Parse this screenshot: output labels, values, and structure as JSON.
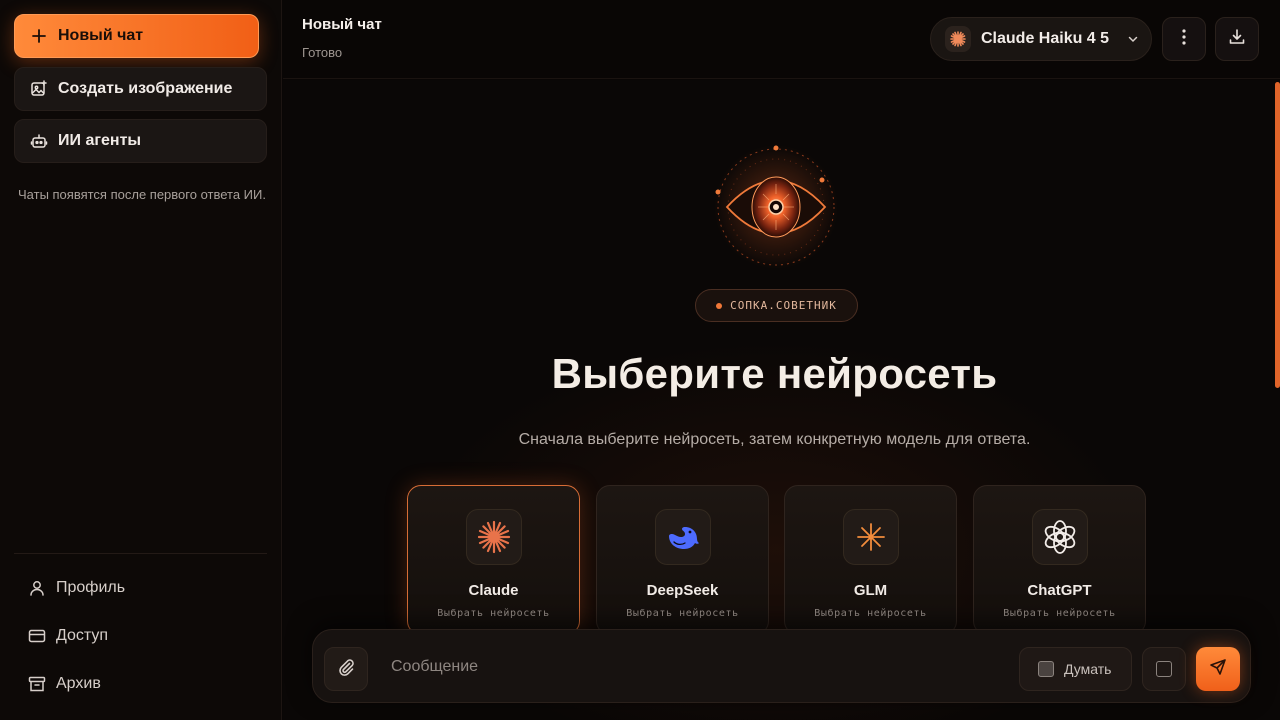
{
  "sidebar": {
    "new_chat_label": "Новый чат",
    "create_image_label": "Создать изображение",
    "agents_label": "ИИ агенты",
    "empty_note": "Чаты появятся после первого ответа ИИ.",
    "links": [
      {
        "label": "Профиль",
        "icon": "user-icon"
      },
      {
        "label": "Доступ",
        "icon": "card-icon"
      },
      {
        "label": "Архив",
        "icon": "archive-icon"
      }
    ]
  },
  "header": {
    "title": "Новый чат",
    "status": "Готово",
    "model_name": "Claude Haiku 4 5"
  },
  "main": {
    "tag": "СОПКА.СОВЕТНИК",
    "title": "Выберите нейросеть",
    "subtitle": "Сначала выберите нейросеть, затем конкретную модель для ответа.",
    "providers": [
      {
        "name": "Claude",
        "sub": "Выбрать нейросеть",
        "icon": "claude-icon",
        "selected": true
      },
      {
        "name": "DeepSeek",
        "sub": "Выбрать нейросеть",
        "icon": "deepseek-whale-icon",
        "selected": false
      },
      {
        "name": "GLM",
        "sub": "Выбрать нейросеть",
        "icon": "glm-icon",
        "selected": false
      },
      {
        "name": "ChatGPT",
        "sub": "Выбрать нейросеть",
        "icon": "openai-icon",
        "selected": false
      }
    ]
  },
  "composer": {
    "placeholder": "Сообщение",
    "think_label": "Думать"
  },
  "colors": {
    "accent": "#f06a22",
    "background": "#0a0706",
    "deepseek_blue": "#4d6bfe"
  }
}
